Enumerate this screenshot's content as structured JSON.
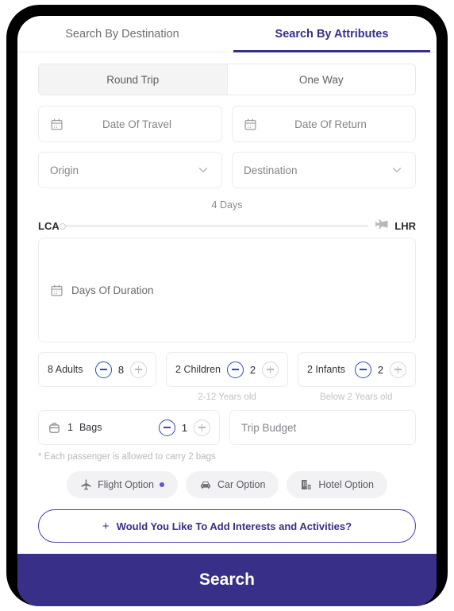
{
  "tabs": [
    {
      "label": "Search By Destination",
      "active": false
    },
    {
      "label": "Search By Attributes",
      "active": true
    }
  ],
  "trip_type": {
    "options": [
      {
        "label": "Round Trip",
        "selected": true
      },
      {
        "label": "One Way",
        "selected": false
      }
    ]
  },
  "dates": {
    "travel_placeholder": "Date Of Travel",
    "return_placeholder": "Date Of Return",
    "travel_icon": "calendar-icon",
    "return_icon": "calendar-icon"
  },
  "locations": {
    "origin_placeholder": "Origin",
    "destination_placeholder": "Destination",
    "chevron_icon": "chevron-down-icon"
  },
  "slider": {
    "origin_code": "LCA",
    "destination_code": "LHR",
    "days_label": "4 Days",
    "days_value": 4,
    "plane_icon": "airplane-icon"
  },
  "duration": {
    "placeholder": "Days Of Duration",
    "icon": "calendar-icon"
  },
  "passengers": [
    {
      "name": "8 Adults",
      "value": "8",
      "sublabel": ""
    },
    {
      "name": "2 Children",
      "value": "2",
      "sublabel": "2-12 Years old"
    },
    {
      "name": "2 Infants",
      "value": "2",
      "sublabel": "Below 2 Years old"
    }
  ],
  "bags": {
    "label": "Bags",
    "count_prefix": "1",
    "value": "1",
    "icon": "briefcase-icon",
    "note": "* Each passenger is allowed to carry 2 bags"
  },
  "budget": {
    "placeholder": "Trip Budget"
  },
  "options": [
    {
      "label": "Flight Option",
      "icon": "airplane-icon",
      "has_dot": true
    },
    {
      "label": "Car Option",
      "icon": "car-icon",
      "has_dot": false
    },
    {
      "label": "Hotel Option",
      "icon": "hotel-icon",
      "has_dot": false
    }
  ],
  "interests": {
    "label": "Would You Like To Add Interests and Activities?",
    "plus": "+"
  },
  "search": {
    "label": "Search"
  },
  "colors": {
    "brand_purple": "#372f88",
    "accent_dot": "#6c4ae0",
    "minus_blue": "#2c4fa8",
    "frame_black": "#000000"
  }
}
